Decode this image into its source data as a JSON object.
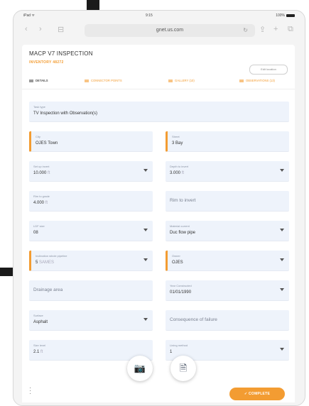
{
  "status_bar": {
    "left": "iPad ᯤ",
    "time": "9:15",
    "right": "100%"
  },
  "browser": {
    "back_icon": "chevron-left-icon",
    "forward_icon": "chevron-right-icon",
    "bookmarks_icon": "book-icon",
    "url": "gnet.us.com",
    "reload_icon": "reload-icon",
    "share_icon": "share-icon",
    "add_tab_icon": "plus-icon",
    "tabs_icon": "tabs-icon"
  },
  "header": {
    "title": "MACP V7 INSPECTION",
    "subtitle": "INVENTORY 48272",
    "edit_button": "Edit location"
  },
  "tabs": [
    {
      "label": "DETAILS",
      "active": true
    },
    {
      "label": "CONNECTOR POINTS",
      "active": false
    },
    {
      "label": "GALLERY (10)",
      "active": false
    },
    {
      "label": "OBSERVATIONS (13)",
      "active": false
    }
  ],
  "form": {
    "task_type": {
      "label": "Task type",
      "value": "TV Inspection with Observation(s)"
    },
    "city": {
      "label": "City",
      "value": "OJES Town"
    },
    "street": {
      "label": "Street",
      "value": "3 Bay"
    },
    "set_up_invert": {
      "label": "Set up invert",
      "value": "10.000",
      "unit": "ft"
    },
    "depth_to_invert": {
      "label": "Depth to invert",
      "value": "3.000",
      "unit": "ft"
    },
    "rim_to_grade": {
      "label": "Rim to grade",
      "value": "4.000",
      "unit": "ft"
    },
    "rim_to_invert": {
      "placeholder": "Rim to invert"
    },
    "ldf_size": {
      "label": "LDF size",
      "value": "08"
    },
    "material_current": {
      "label": "Material current",
      "value": "Duc flow pipe"
    },
    "inclination": {
      "label": "Inclination whole pipeline",
      "value": "5",
      "unit": "SAMES"
    },
    "owner": {
      "label": "Owner",
      "value": "OJES"
    },
    "drainage_area": {
      "placeholder": "Drainage area"
    },
    "year_constructed": {
      "label": "Year Constructed",
      "value": "01/01/1990"
    },
    "surface": {
      "label": "Surface",
      "value": "Asphalt"
    },
    "consequence": {
      "placeholder": "Consequence of failure"
    },
    "size_level": {
      "label": "Size level",
      "value": "2.1",
      "unit": "ft"
    },
    "lining_method": {
      "label": "Lining method",
      "value": "1"
    }
  },
  "bottom": {
    "more_icon": "more-vertical-icon",
    "camera_icon": "camera-icon",
    "document_icon": "document-icon",
    "complete_button": "✓  COMPLETE"
  }
}
